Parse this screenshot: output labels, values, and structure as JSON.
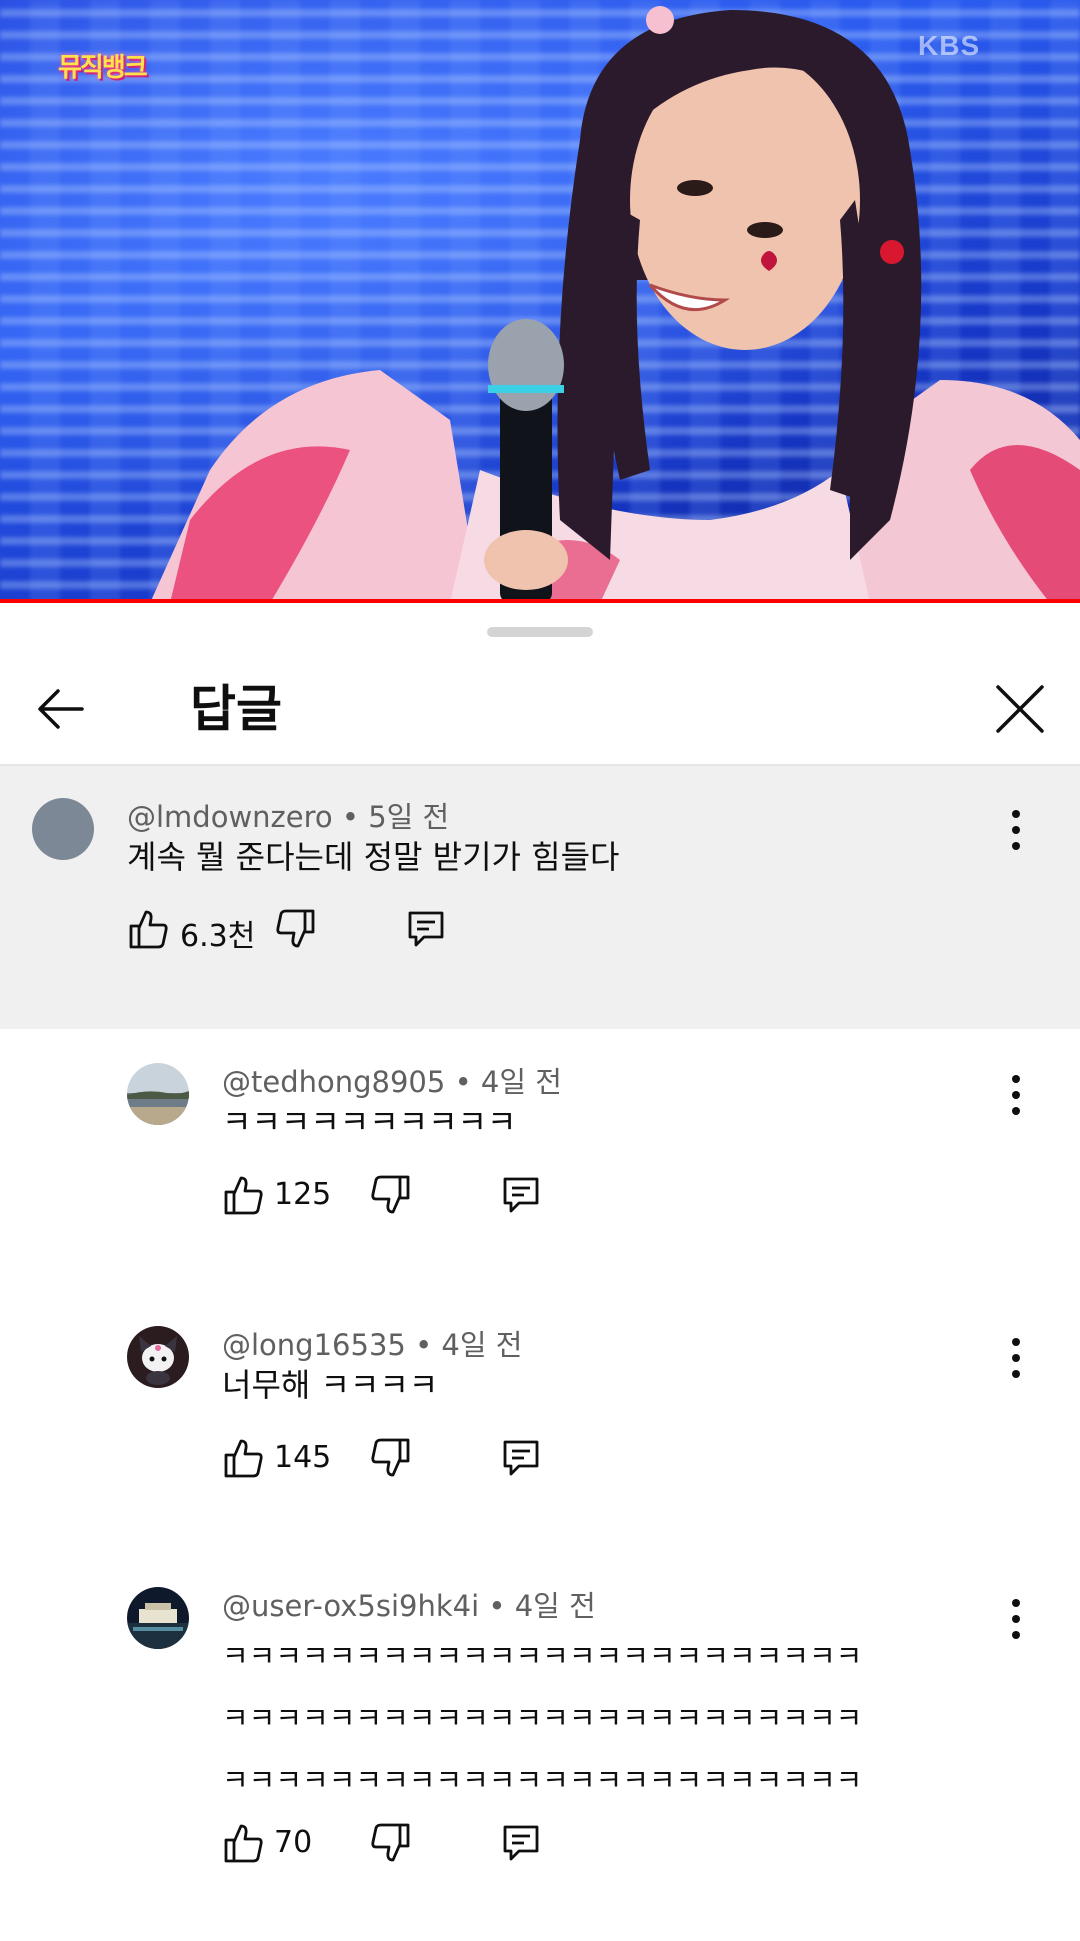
{
  "video": {
    "show_logo_text": "뮤직뱅크",
    "channel_watermark": "KBS",
    "progress_fraction": 1.0,
    "colors": {
      "background": "#2349e0",
      "progress": "#ff0000"
    }
  },
  "sheet": {
    "title": "답글"
  },
  "parent_comment": {
    "author": "@lmdownzero",
    "time": "5일 전",
    "text": "계속 뭘 준다는데 정말 받기가 힘들다",
    "likes": "6.3천",
    "avatar_color": "#7d8896"
  },
  "replies": [
    {
      "author": "@tedhong8905",
      "time": "4일 전",
      "text": "ㅋㅋㅋㅋㅋㅋㅋㅋㅋㅋ",
      "likes": "125"
    },
    {
      "author": "@long16535",
      "time": "4일 전",
      "text": "너무해 ㅋㅋㅋㅋ",
      "likes": "145"
    },
    {
      "author": "@user-ox5si9hk4i",
      "time": "4일 전",
      "text": "ㅋㅋㅋㅋㅋㅋㅋㅋㅋㅋㅋㅋㅋㅋㅋㅋㅋㅋㅋㅋㅋㅋㅋㅋ\nㅋㅋㅋㅋㅋㅋㅋㅋㅋㅋㅋㅋㅋㅋㅋㅋㅋㅋㅋㅋㅋㅋㅋㅋ\nㅋㅋㅋㅋㅋㅋㅋㅋㅋㅋㅋㅋㅋㅋㅋㅋㅋㅋㅋㅋㅋㅋㅋㅋ",
      "likes": "70"
    }
  ],
  "meta_separator": "•",
  "icons": [
    "back-arrow-icon",
    "close-icon",
    "more-vert-icon",
    "thumb-up-icon",
    "thumb-down-icon",
    "reply-icon"
  ]
}
